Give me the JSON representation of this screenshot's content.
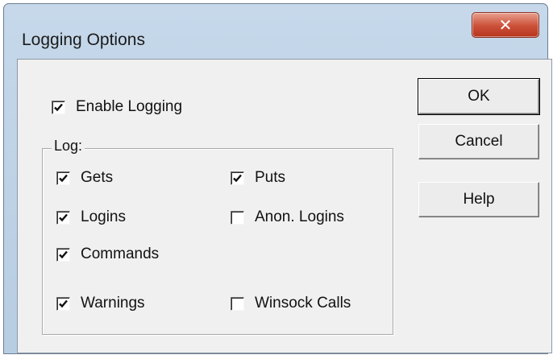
{
  "window": {
    "title": "Logging Options",
    "close_icon": "close-icon"
  },
  "enable_logging": {
    "label": "Enable Logging",
    "checked": true
  },
  "log_group": {
    "label": "Log:",
    "items": [
      {
        "label": "Gets",
        "checked": true
      },
      {
        "label": "Puts",
        "checked": true
      },
      {
        "label": "Logins",
        "checked": true
      },
      {
        "label": "Anon. Logins",
        "checked": false
      },
      {
        "label": "Commands",
        "checked": true
      },
      {
        "label": "Warnings",
        "checked": true
      },
      {
        "label": "Winsock Calls",
        "checked": false
      }
    ]
  },
  "buttons": {
    "ok": "OK",
    "cancel": "Cancel",
    "help": "Help"
  }
}
